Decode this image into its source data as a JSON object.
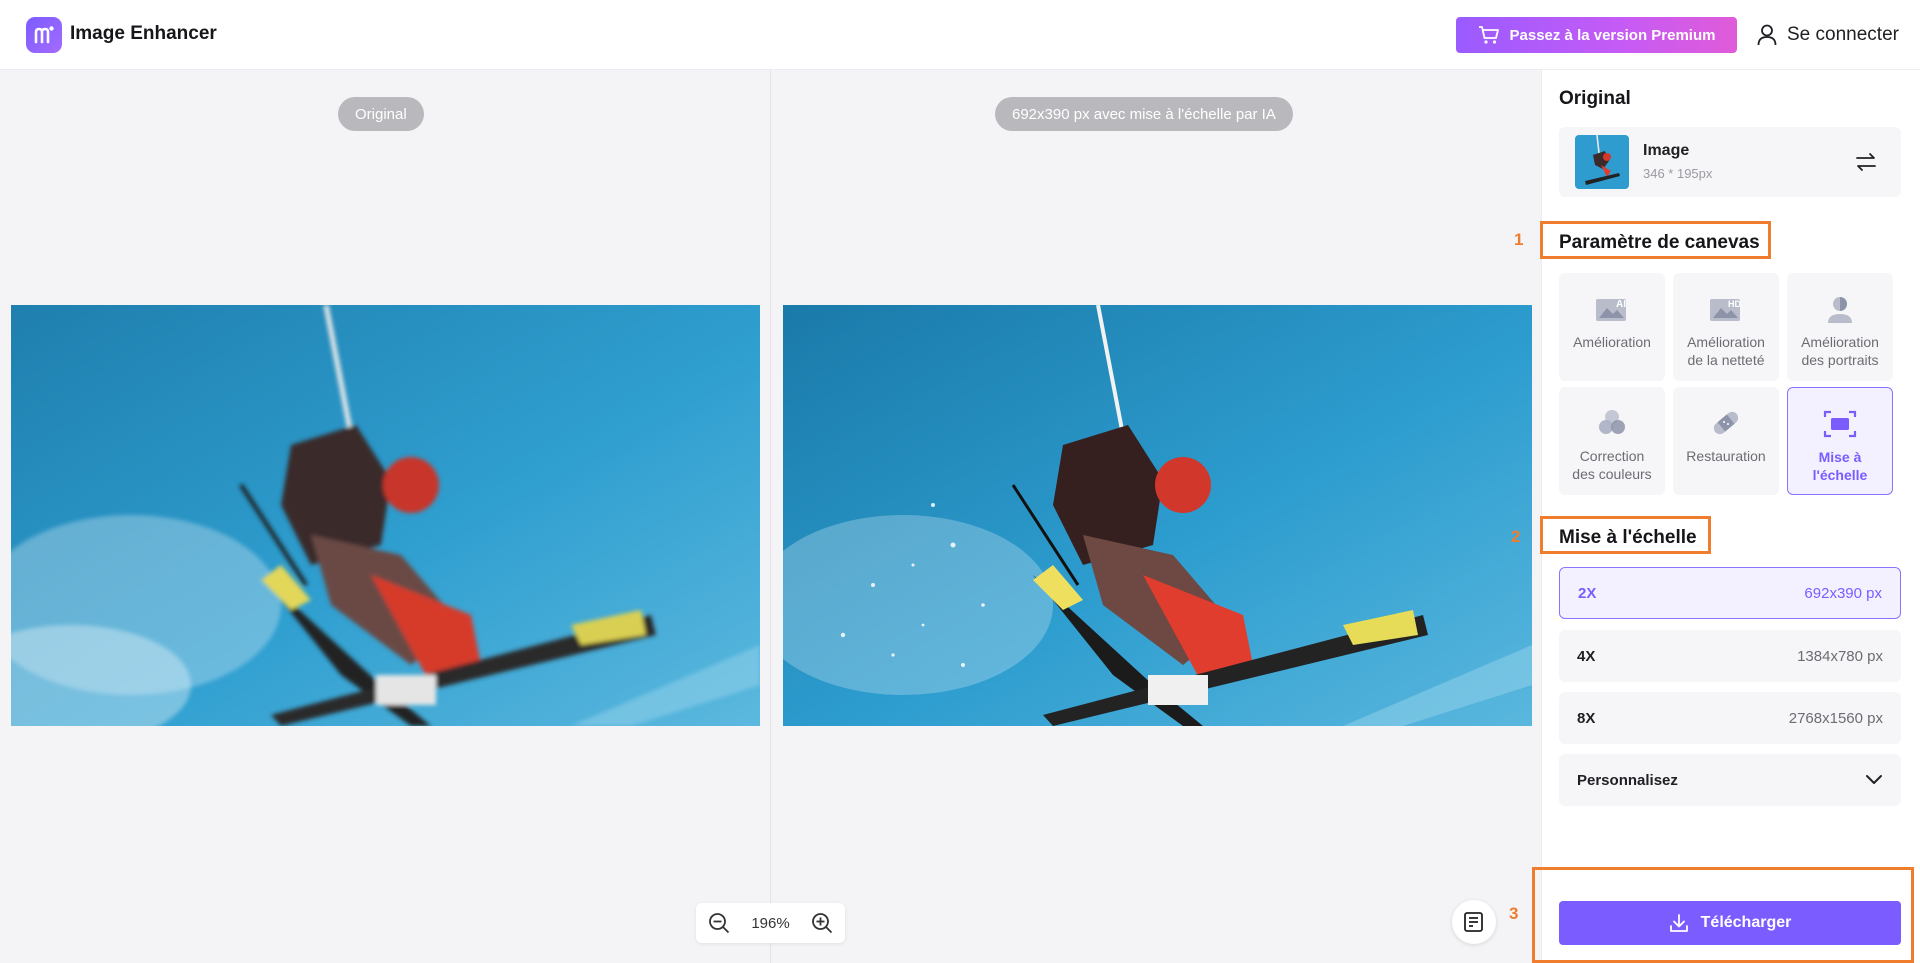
{
  "header": {
    "app_name": "Image Enhancer",
    "premium_label": "Passez à la version Premium",
    "login_label": "Se connecter"
  },
  "canvas": {
    "original_label": "Original",
    "result_label": "692x390 px avec mise à l'échelle par IA",
    "zoom_value": "196%"
  },
  "sidebar": {
    "original_title": "Original",
    "image": {
      "name": "Image",
      "dims": "346 * 195px"
    },
    "canvas_settings_title": "Paramètre de canevas",
    "tools": [
      {
        "label": "Amélioration",
        "icon": "ai-image-icon"
      },
      {
        "label": "Amélioration\nde la netteté",
        "icon": "hd-image-icon"
      },
      {
        "label": "Amélioration\ndes portraits",
        "icon": "portrait-icon"
      },
      {
        "label": "Correction\ndes couleurs",
        "icon": "color-circles-icon"
      },
      {
        "label": "Restauration",
        "icon": "bandage-icon"
      },
      {
        "label": "Mise à\nl'échelle",
        "icon": "upscale-icon",
        "active": true
      }
    ],
    "scale_title": "Mise à l'échelle",
    "scale_options": [
      {
        "factor": "2X",
        "size": "692x390 px",
        "active": true
      },
      {
        "factor": "4X",
        "size": "1384x780 px"
      },
      {
        "factor": "8X",
        "size": "2768x1560 px"
      }
    ],
    "custom_label": "Personnalisez",
    "download_label": "Télécharger"
  },
  "annotations": {
    "n1": "1",
    "n2": "2",
    "n3": "3"
  },
  "colors": {
    "accent": "#7b5cff",
    "highlight": "#f07d2e",
    "premium_start": "#9a5bff",
    "premium_end": "#e05bd8"
  }
}
